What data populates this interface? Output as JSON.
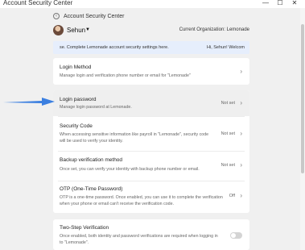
{
  "window": {
    "title": "Account Security Center",
    "controls": {
      "minimize": "—",
      "maximize": "☐",
      "close": "✕"
    }
  },
  "header": {
    "title": "Account Security Center"
  },
  "user": {
    "name": "Sehun",
    "organization": "Current Organization: Lemonade"
  },
  "banner": {
    "left_text": "se. Complete Lemonade account security settings here.",
    "right_text": "Hi, Sehun! Welcom"
  },
  "settings": {
    "login_method": {
      "title": "Login Method",
      "description": "Manage login and verification phone number or email for \"Lemonade\""
    },
    "login_password": {
      "title": "Login password",
      "description": "Manage login password at Lemonade.",
      "status": "Not set"
    },
    "security_code": {
      "title": "Security Code",
      "description": "When accessing sensitive information like payroll in \"Lemonade\", security code will be used to verify your identity.",
      "status": "Not set"
    },
    "backup_verification": {
      "title": "Backup verification method",
      "description": "Once set, you can verify your identity with backup phone number or email.",
      "status": "Not set"
    },
    "otp": {
      "title": "OTP (One-Time Password)",
      "description": "OTP is a one-time password. Once enabled, you can use it to complete the verification when your phone or email can't receive the verification code.",
      "status": "Off"
    },
    "two_step": {
      "title": "Two-Step Verification",
      "description": "Once enabled, both identity and password verifications are required when logging in to \"Lemonade\".",
      "enabled": false
    }
  },
  "colors": {
    "arrow": "#3b7fe0",
    "banner_bg": "#e6eefc",
    "highlight_bg": "#efefef"
  }
}
